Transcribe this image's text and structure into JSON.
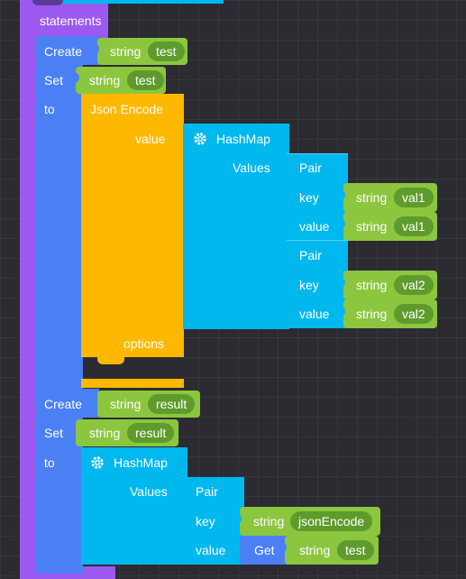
{
  "colors": {
    "workspace": "#2b2b31",
    "function_block": "#9b59f0",
    "variable_block": "#4a80f4",
    "json_block": "#ffb800",
    "hashmap_block": "#00b7ee",
    "string_block": "#8cc63f",
    "string_value": "#5e9b2c"
  },
  "labels": {
    "statements": "statements",
    "create": "Create",
    "set": "Set",
    "to": "to",
    "string": "string",
    "json_encode": "Json Encode",
    "value": "value",
    "options": "options",
    "hashmap": "HashMap",
    "values": "Values",
    "pair": "Pair",
    "key": "key",
    "get": "Get"
  },
  "icons": {
    "hashmap": "gear-icon"
  },
  "blocks": {
    "create_1": {
      "var": "test"
    },
    "set_1": {
      "var": "test"
    },
    "pair_1": {
      "key": "val1",
      "value": "val1"
    },
    "pair_2": {
      "key": "val2",
      "value": "val2"
    },
    "create_2": {
      "var": "result"
    },
    "set_2": {
      "var": "result"
    },
    "pair_3": {
      "key": "jsonEncode",
      "get_var": "test"
    }
  }
}
